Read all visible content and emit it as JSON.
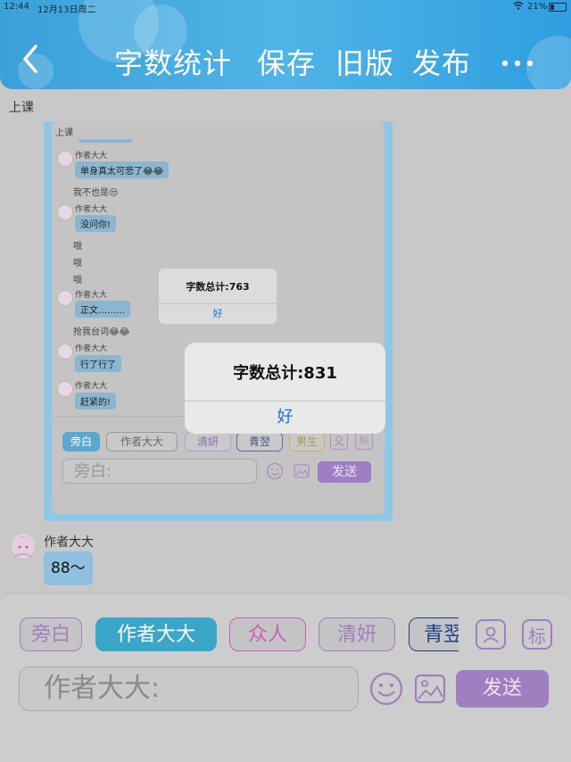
{
  "status": {
    "time": "12:44",
    "date": "12月13日周二",
    "battery": "21%"
  },
  "header": {
    "back": "‹",
    "word_count": "字数统计",
    "save": "保存",
    "old_version": "旧版",
    "publish": "发布",
    "more": "•••"
  },
  "chapter_label": "上课",
  "screenshot": {
    "chapter_label": "上课",
    "messages": [
      {
        "type": "author",
        "name": "作者大大",
        "text": "单身真太可悲了😂😂"
      },
      {
        "type": "narration",
        "text": "我不也是😒"
      },
      {
        "type": "author",
        "name": "作者大大",
        "text": "没问你!"
      },
      {
        "type": "narration",
        "text": "哦"
      },
      {
        "type": "narration",
        "text": "哦"
      },
      {
        "type": "narration",
        "text": "哦"
      },
      {
        "type": "author",
        "name": "作者大大",
        "text": "正文………"
      },
      {
        "type": "narration",
        "text": "抢我台词😂😂"
      },
      {
        "type": "author",
        "name": "作者大大",
        "text": "行了行了"
      },
      {
        "type": "author",
        "name": "作者大大",
        "text": "赶紧的!"
      }
    ],
    "chips": [
      "旁白",
      "作者大大",
      "清妍",
      "青翌",
      "男生"
    ],
    "mark_icon": "标",
    "input_placeholder": "旁白:",
    "send": "发送",
    "dialog": {
      "title": "字数总计:763",
      "ok": "好"
    }
  },
  "dialog": {
    "title": "字数总计:831",
    "ok": "好"
  },
  "last_message": {
    "name": "作者大大",
    "text": "88～"
  },
  "composer": {
    "chips": [
      {
        "label": "旁白",
        "color": "#a07fc0",
        "active": false
      },
      {
        "label": "作者大大",
        "color": "#3aa6c8",
        "active": true
      },
      {
        "label": "众人",
        "color": "#d05ac0",
        "active": false
      },
      {
        "label": "清妍",
        "color": "#a07fc0",
        "active": false
      },
      {
        "label": "青翌",
        "color": "#1f3f8a",
        "active": false
      }
    ],
    "mark_icon": "标",
    "input_placeholder": "作者大大:",
    "send": "发送"
  },
  "colors": {
    "header": "#4fb4e6",
    "accent_purple": "#a07fc0",
    "send_button": "#a07fc0",
    "dialog_button": "#1a6fe0"
  },
  "icons": [
    "back-icon",
    "more-icon",
    "person-icon",
    "mark-icon",
    "emoji-icon",
    "image-icon",
    "wifi-icon",
    "battery-icon"
  ]
}
